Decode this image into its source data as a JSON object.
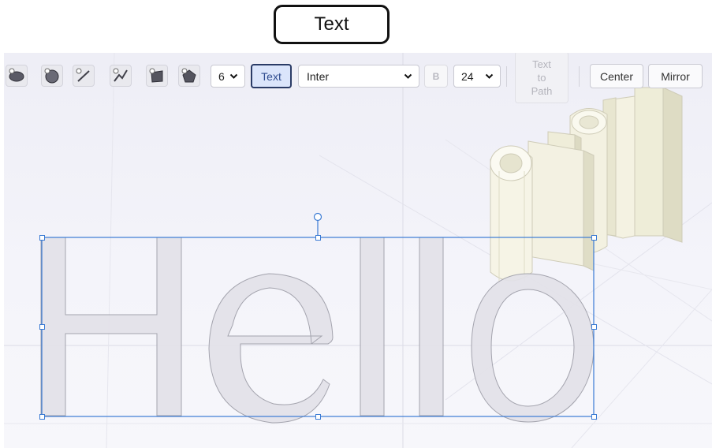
{
  "header": {
    "label": "Text"
  },
  "toolbar": {
    "shape_buttons": [
      {
        "name": "ellipse-tool-icon"
      },
      {
        "name": "circle-tool-icon"
      },
      {
        "name": "line-tool-icon"
      },
      {
        "name": "path-tool-icon"
      },
      {
        "name": "rectangle-tool-icon"
      },
      {
        "name": "polygon-tool-icon"
      }
    ],
    "sides_value": "6",
    "text_button": "Text",
    "font_value": "Inter",
    "bold_label": "B",
    "size_value": "24",
    "text_to_path": [
      "Text",
      "to",
      "Path"
    ],
    "center_button": "Center",
    "mirror_button": "Mirror"
  },
  "canvas": {
    "text_content": "Hello",
    "selection_color": "#3b7bd4",
    "extruded_color": "#f2f0df"
  }
}
